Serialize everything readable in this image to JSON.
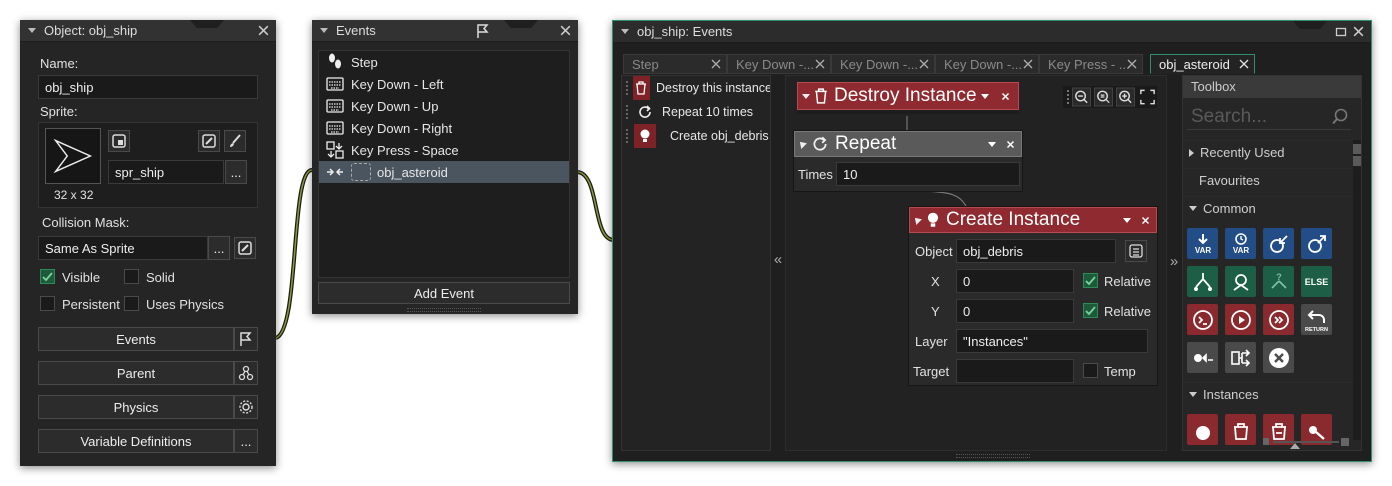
{
  "object_window": {
    "title": "Object: obj_ship",
    "name_label": "Name:",
    "name_value": "obj_ship",
    "sprite_label": "Sprite:",
    "sprite_name": "spr_ship",
    "sprite_size": "32 x 32",
    "collision_label": "Collision Mask:",
    "collision_value": "Same As Sprite",
    "checkboxes": [
      {
        "label": "Visible",
        "checked": true
      },
      {
        "label": "Solid",
        "checked": false
      },
      {
        "label": "Persistent",
        "checked": false
      },
      {
        "label": "Uses Physics",
        "checked": false
      }
    ],
    "buttons": {
      "events": "Events",
      "parent": "Parent",
      "physics": "Physics",
      "variables": "Variable Definitions",
      "more": "..."
    }
  },
  "events_window": {
    "title": "Events",
    "events": [
      {
        "label": "Step",
        "icon": "footsteps-icon"
      },
      {
        "label": "Key Down - Left",
        "icon": "keyboard-icon"
      },
      {
        "label": "Key Down - Up",
        "icon": "keyboard-icon"
      },
      {
        "label": "Key Down - Right",
        "icon": "keyboard-icon"
      },
      {
        "label": "Key Press - Space",
        "icon": "key-press-icon"
      },
      {
        "label": "obj_asteroid",
        "icon": "collision-icon",
        "selected": true
      }
    ],
    "add_event": "Add Event"
  },
  "editor_window": {
    "title": "obj_ship: Events",
    "tabs": [
      {
        "label": "Step"
      },
      {
        "label": "Key Down -..."
      },
      {
        "label": "Key Down -..."
      },
      {
        "label": "Key Down -..."
      },
      {
        "label": "Key Press - ..."
      },
      {
        "label": "obj_asteroid",
        "active": true
      }
    ],
    "action_list": [
      {
        "label": "Destroy this instance",
        "icon": "trash-icon"
      },
      {
        "label": "Repeat 10 times",
        "icon": "repeat-icon"
      },
      {
        "label": "Create obj_debris",
        "icon": "bulb-icon"
      }
    ],
    "collapse_left": "«",
    "collapse_right": "»",
    "actions": {
      "destroy": {
        "title": "Destroy Instance"
      },
      "repeat": {
        "title": "Repeat",
        "times_label": "Times",
        "times_value": "10"
      },
      "create": {
        "title": "Create Instance",
        "object_label": "Object",
        "object_value": "obj_debris",
        "x_label": "X",
        "x_value": "0",
        "y_label": "Y",
        "y_value": "0",
        "relative_label": "Relative",
        "layer_label": "Layer",
        "layer_value": "\"Instances\"",
        "target_label": "Target",
        "target_value": "",
        "temp_label": "Temp"
      }
    },
    "toolbox": {
      "title": "Toolbox",
      "search_placeholder": "Search...",
      "sections": [
        "Recently Used",
        "Favourites",
        "Common",
        "Instances"
      ],
      "common_row1_labels": [
        "VAR",
        "VAR",
        "",
        ""
      ],
      "else_label": "ELSE",
      "return_label": "RETURN"
    }
  },
  "colors": {
    "accent_green": "#2f8f6a",
    "action_red": "#8e2a30",
    "toolbox_blue": "#234d86",
    "toolbox_green": "#1d5e46",
    "toolbox_red": "#8a2a2e",
    "link_olive": "#7a8a2a"
  }
}
